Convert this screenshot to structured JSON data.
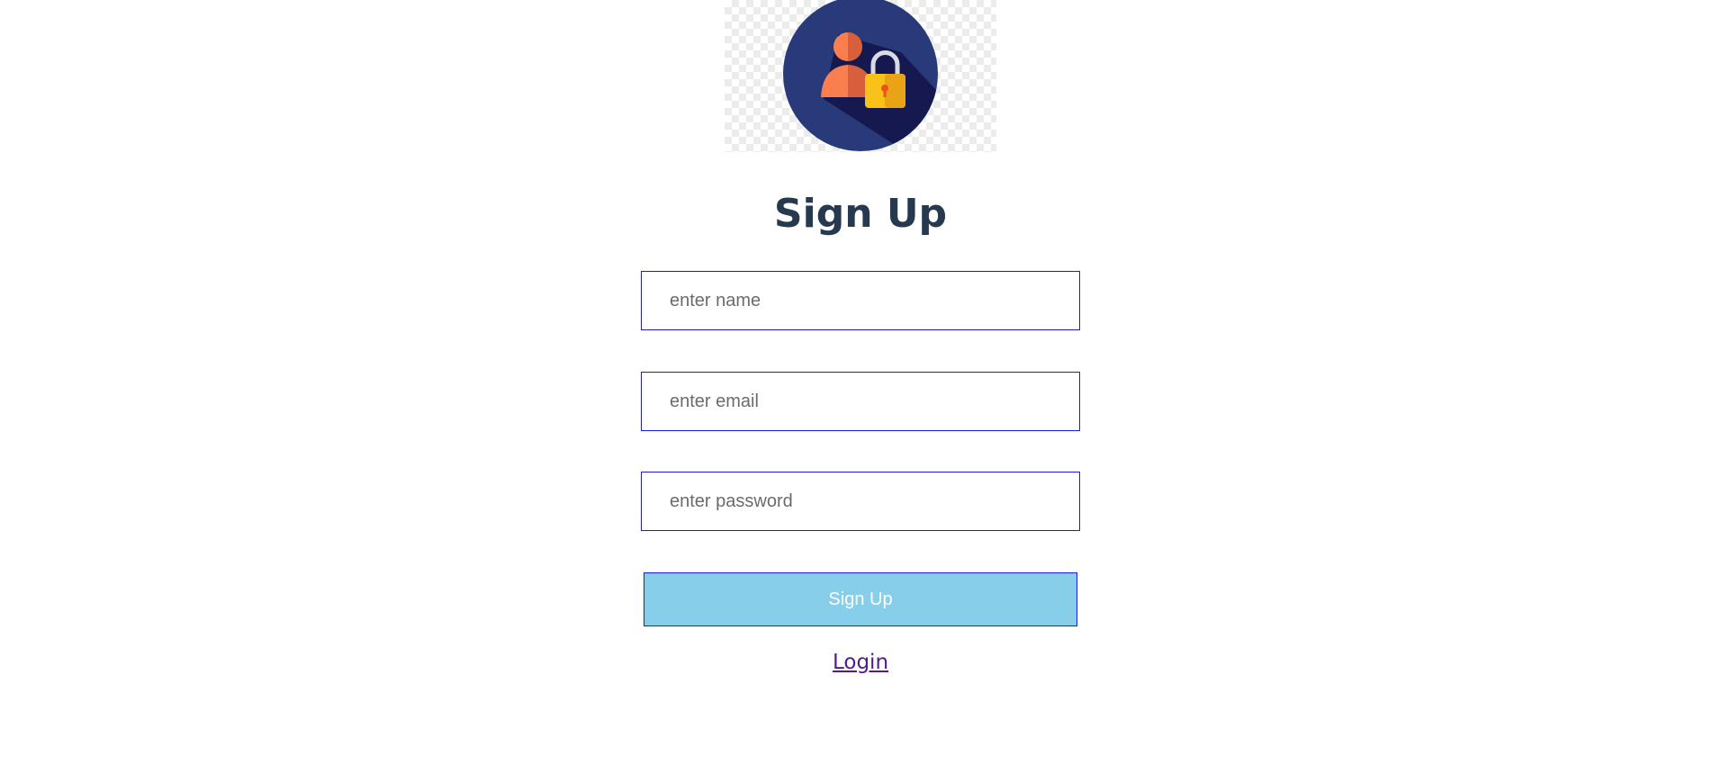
{
  "logo": {
    "icon": "user-lock-icon",
    "colors": {
      "circle": "#283a7a",
      "shadow": "#161850",
      "person": "#fa7e4e",
      "person_dark": "#d75f3b",
      "lock_body": "#f8c218",
      "lock_shade": "#e9a416",
      "shackle": "#d8dbe4",
      "keyhole": "#f04e1b"
    }
  },
  "form": {
    "title": "Sign Up",
    "name_placeholder": "enter name",
    "email_placeholder": "enter email",
    "password_placeholder": "enter password",
    "submit_label": "Sign Up",
    "login_link_label": "Login"
  },
  "theme": {
    "title_color": "#26394f",
    "input_border": "#1a1ae0",
    "button_bg": "#87ceeb",
    "button_text": "#ffffff",
    "link_color": "#551a8b"
  }
}
